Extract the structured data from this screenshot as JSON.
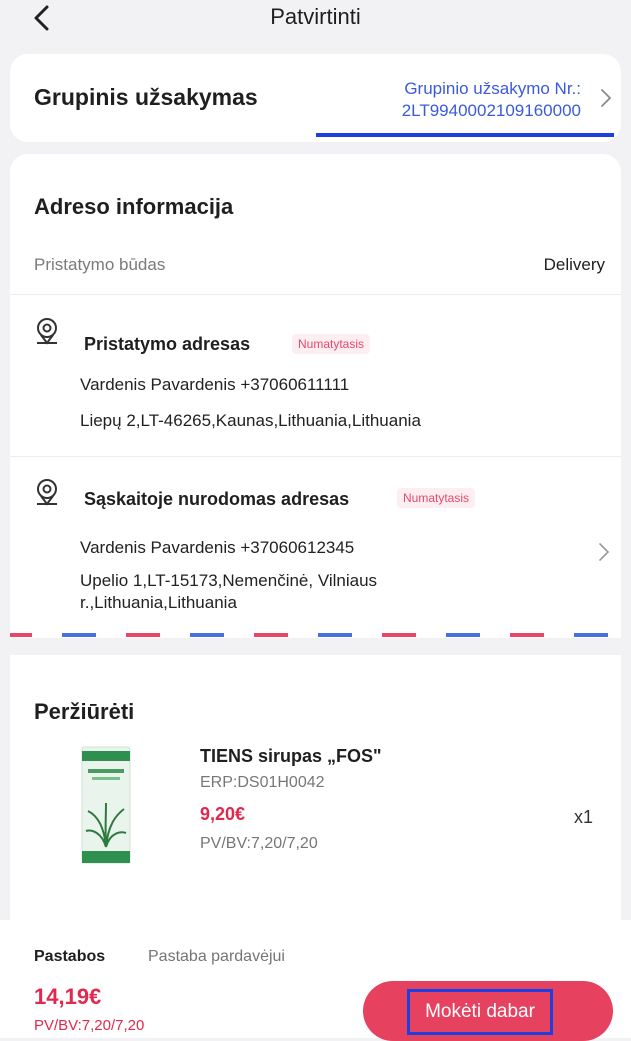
{
  "header": {
    "title": "Patvirtinti",
    "back_icon": "chevron-left-icon"
  },
  "group_order": {
    "label": "Grupinis užsakymas",
    "number_label": "Grupinio užsakymo Nr.:",
    "number_value": "2LT9940002109160000",
    "underline_color": "#1e3fe0"
  },
  "address_info": {
    "title": "Adreso informacija",
    "delivery_method_label": "Pristatymo būdas",
    "delivery_method_value": "Delivery",
    "shipping": {
      "icon": "map-pin-icon",
      "title": "Pristatymo adresas",
      "badge": "Numatytasis",
      "contact": "Vardenis Pavardenis +37060611111",
      "address": "Liepų 2,LT-46265,Kaunas,Lithuania,Lithuania"
    },
    "billing": {
      "icon": "map-pin-icon",
      "title": "Sąskaitoje nurodomas adresas",
      "badge": "Numatytasis",
      "contact": "Vardenis Pavardenis +37060612345",
      "address": "Upelio 1,LT-15173,Nemenčinė, Vilniaus r.,Lithuania,Lithuania"
    }
  },
  "review": {
    "title": "Peržiūrėti",
    "product": {
      "name": "TIENS sirupas „FOS\"",
      "code": "ERP:DS01H0042",
      "price": "9,20€",
      "pv_bv": "PV/BV:7,20/7,20",
      "quantity": "x1"
    }
  },
  "footer": {
    "notes_label": "Pastabos",
    "notes_placeholder": "Pastaba pardavėjui",
    "total": "14,19€",
    "total_pv_bv": "PV/BV:7,20/7,20",
    "pay_button": "Mokėti dabar"
  },
  "colors": {
    "accent": "#e6415f",
    "price": "#e0294f",
    "link": "#3a5bd9",
    "highlight": "#1e3fe0"
  }
}
